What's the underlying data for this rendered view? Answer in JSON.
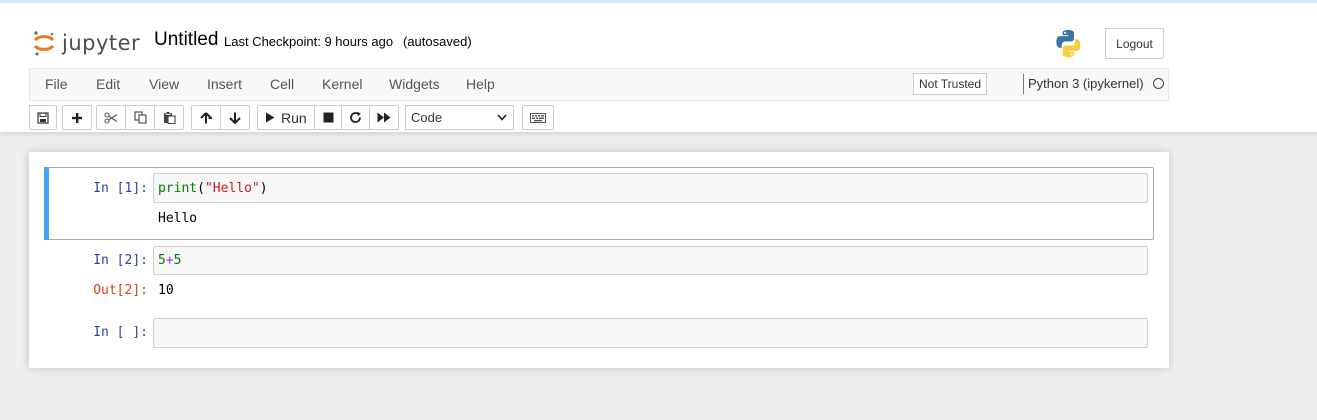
{
  "header": {
    "logo_text": "jupyter",
    "notebook_title": "Untitled",
    "checkpoint": "Last Checkpoint: 9 hours ago",
    "autosave": "(autosaved)",
    "logout_label": "Logout"
  },
  "menubar": {
    "items": [
      "File",
      "Edit",
      "View",
      "Insert",
      "Cell",
      "Kernel",
      "Widgets",
      "Help"
    ],
    "trust_label": "Not Trusted",
    "kernel_name": "Python 3 (ipykernel)"
  },
  "toolbar": {
    "run_label": "Run",
    "cell_type": "Code",
    "cell_type_options": [
      "Code"
    ]
  },
  "cells": [
    {
      "prompt": "In [1]:",
      "code_tokens": [
        {
          "text": "print",
          "kind": "builtin"
        },
        {
          "text": "(",
          "kind": "plain"
        },
        {
          "text": "\"Hello\"",
          "kind": "string"
        },
        {
          "text": ")",
          "kind": "plain"
        }
      ],
      "output": "Hello",
      "selected": true
    },
    {
      "prompt": "In [2]:",
      "code_tokens": [
        {
          "text": "5",
          "kind": "num"
        },
        {
          "text": "+",
          "kind": "op"
        },
        {
          "text": "5",
          "kind": "num"
        }
      ],
      "out_prompt": "Out[2]:",
      "output": "10"
    },
    {
      "prompt": "In [ ]:",
      "code_tokens": []
    }
  ],
  "colors": {
    "selected_bar": "#42a5f5",
    "in_prompt": "#303f9f",
    "out_prompt": "#d84315"
  }
}
